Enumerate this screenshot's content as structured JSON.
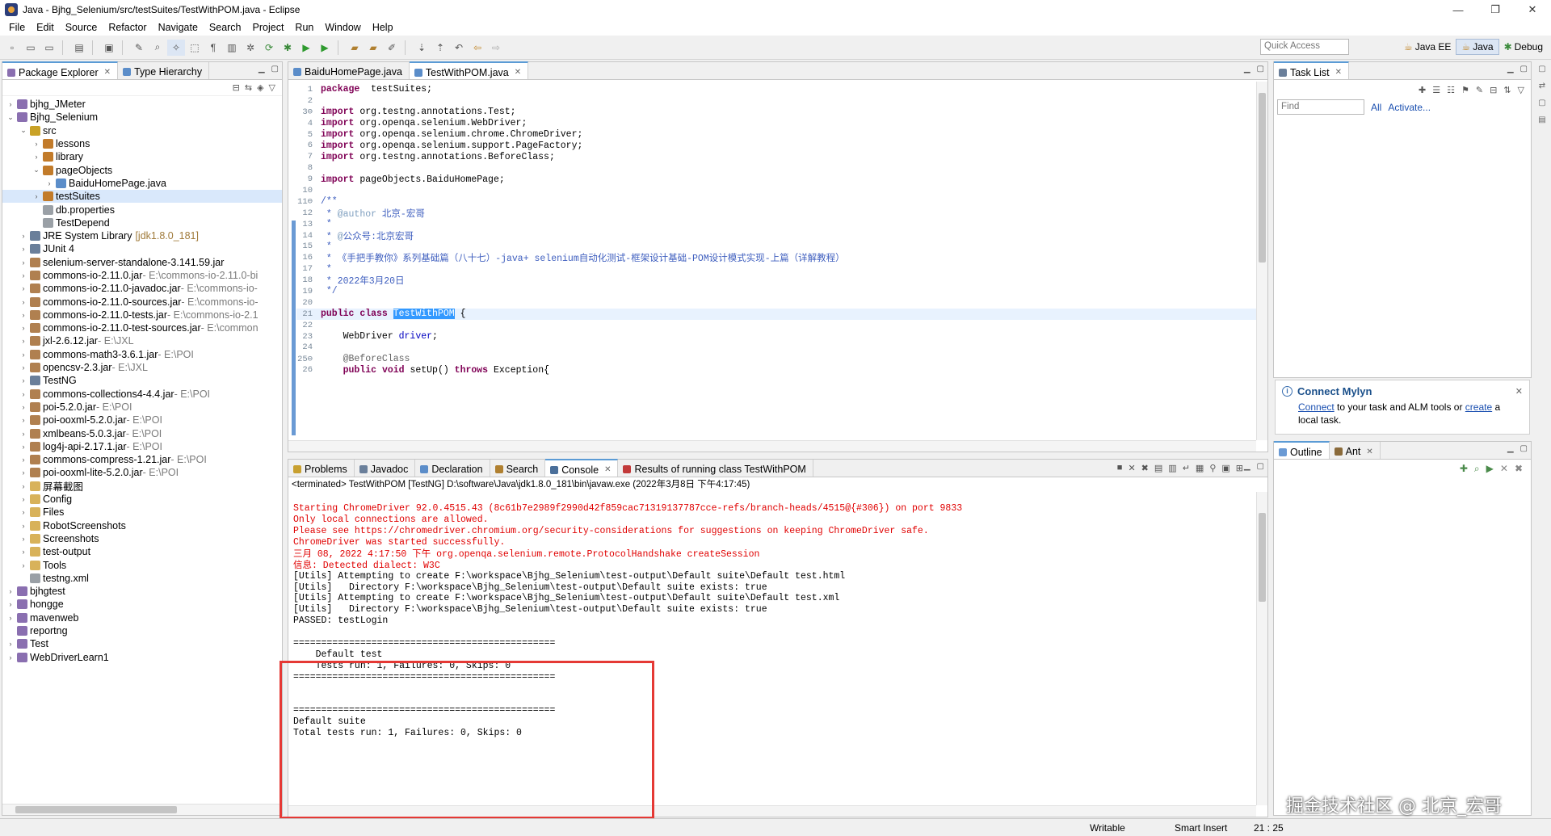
{
  "window": {
    "title": "Java - Bjhg_Selenium/src/testSuites/TestWithPOM.java - Eclipse",
    "minimize": "—",
    "restore": "❐",
    "close": "✕"
  },
  "menu": [
    "File",
    "Edit",
    "Source",
    "Refactor",
    "Navigate",
    "Search",
    "Project",
    "Run",
    "Window",
    "Help"
  ],
  "quick_access": {
    "placeholder": "Quick Access"
  },
  "perspectives": [
    "Java EE",
    "Java",
    "Debug"
  ],
  "package_explorer": {
    "tabs": [
      "Package Explorer",
      "Type Hierarchy"
    ],
    "tree": [
      {
        "label": "bjhg_JMeter",
        "indent": 0,
        "arrow": "›",
        "color": "#8a6fb0"
      },
      {
        "label": "Bjhg_Selenium",
        "indent": 0,
        "arrow": "⌄",
        "color": "#8a6fb0"
      },
      {
        "label": "src",
        "indent": 1,
        "arrow": "⌄",
        "color": "#c9a227"
      },
      {
        "label": "lessons",
        "indent": 2,
        "arrow": "›",
        "color": "#c27b2a"
      },
      {
        "label": "library",
        "indent": 2,
        "arrow": "›",
        "color": "#c27b2a"
      },
      {
        "label": "pageObjects",
        "indent": 2,
        "arrow": "⌄",
        "color": "#c27b2a"
      },
      {
        "label": "BaiduHomePage.java",
        "indent": 3,
        "arrow": "›",
        "color": "#5b8dc9"
      },
      {
        "label": "testSuites",
        "indent": 2,
        "arrow": "›",
        "color": "#c27b2a",
        "selected": true
      },
      {
        "label": "db.properties",
        "indent": 2,
        "arrow": "",
        "color": "#9aa0a6"
      },
      {
        "label": "TestDepend",
        "indent": 2,
        "arrow": "",
        "color": "#9aa0a6"
      },
      {
        "label": "JRE System Library",
        "extra": "[jdk1.8.0_181]",
        "extraClass": "jdk",
        "indent": 1,
        "arrow": "›",
        "color": "#6a7f9a"
      },
      {
        "label": "JUnit 4",
        "indent": 1,
        "arrow": "›",
        "color": "#6a7f9a"
      },
      {
        "label": "selenium-server-standalone-3.141.59.jar",
        "indent": 1,
        "arrow": "›",
        "color": "#b08050"
      },
      {
        "label": "commons-io-2.11.0.jar",
        "extra": " - E:\\commons-io-2.11.0-bi",
        "indent": 1,
        "arrow": "›",
        "color": "#b08050"
      },
      {
        "label": "commons-io-2.11.0-javadoc.jar",
        "extra": " - E:\\commons-io-",
        "indent": 1,
        "arrow": "›",
        "color": "#b08050"
      },
      {
        "label": "commons-io-2.11.0-sources.jar",
        "extra": " - E:\\commons-io-",
        "indent": 1,
        "arrow": "›",
        "color": "#b08050"
      },
      {
        "label": "commons-io-2.11.0-tests.jar",
        "extra": " - E:\\commons-io-2.1",
        "indent": 1,
        "arrow": "›",
        "color": "#b08050"
      },
      {
        "label": "commons-io-2.11.0-test-sources.jar",
        "extra": " - E:\\common",
        "indent": 1,
        "arrow": "›",
        "color": "#b08050"
      },
      {
        "label": "jxl-2.6.12.jar",
        "extra": " - E:\\JXL",
        "indent": 1,
        "arrow": "›",
        "color": "#b08050"
      },
      {
        "label": "commons-math3-3.6.1.jar",
        "extra": " - E:\\POI",
        "indent": 1,
        "arrow": "›",
        "color": "#b08050"
      },
      {
        "label": "opencsv-2.3.jar",
        "extra": " - E:\\JXL",
        "indent": 1,
        "arrow": "›",
        "color": "#b08050"
      },
      {
        "label": "TestNG",
        "indent": 1,
        "arrow": "›",
        "color": "#6a7f9a"
      },
      {
        "label": "commons-collections4-4.4.jar",
        "extra": " - E:\\POI",
        "indent": 1,
        "arrow": "›",
        "color": "#b08050"
      },
      {
        "label": "poi-5.2.0.jar",
        "extra": " - E:\\POI",
        "indent": 1,
        "arrow": "›",
        "color": "#b08050"
      },
      {
        "label": "poi-ooxml-5.2.0.jar",
        "extra": " - E:\\POI",
        "indent": 1,
        "arrow": "›",
        "color": "#b08050"
      },
      {
        "label": "xmlbeans-5.0.3.jar",
        "extra": " - E:\\POI",
        "indent": 1,
        "arrow": "›",
        "color": "#b08050"
      },
      {
        "label": "log4j-api-2.17.1.jar",
        "extra": " - E:\\POI",
        "indent": 1,
        "arrow": "›",
        "color": "#b08050"
      },
      {
        "label": "commons-compress-1.21.jar",
        "extra": " - E:\\POI",
        "indent": 1,
        "arrow": "›",
        "color": "#b08050"
      },
      {
        "label": "poi-ooxml-lite-5.2.0.jar",
        "extra": " - E:\\POI",
        "indent": 1,
        "arrow": "›",
        "color": "#b08050"
      },
      {
        "label": "屏幕截图",
        "indent": 1,
        "arrow": "›",
        "color": "#d8b25a"
      },
      {
        "label": "Config",
        "indent": 1,
        "arrow": "›",
        "color": "#d8b25a"
      },
      {
        "label": "Files",
        "indent": 1,
        "arrow": "›",
        "color": "#d8b25a"
      },
      {
        "label": "RobotScreenshots",
        "indent": 1,
        "arrow": "›",
        "color": "#d8b25a"
      },
      {
        "label": "Screenshots",
        "indent": 1,
        "arrow": "›",
        "color": "#d8b25a"
      },
      {
        "label": "test-output",
        "indent": 1,
        "arrow": "›",
        "color": "#d8b25a"
      },
      {
        "label": "Tools",
        "indent": 1,
        "arrow": "›",
        "color": "#d8b25a"
      },
      {
        "label": "testng.xml",
        "indent": 1,
        "arrow": "",
        "color": "#9aa0a6"
      },
      {
        "label": "bjhgtest",
        "indent": 0,
        "arrow": "›",
        "color": "#8a6fb0"
      },
      {
        "label": "hongge",
        "indent": 0,
        "arrow": "›",
        "color": "#8a6fb0"
      },
      {
        "label": "mavenweb",
        "indent": 0,
        "arrow": "›",
        "color": "#8a6fb0"
      },
      {
        "label": "reportng",
        "indent": 0,
        "arrow": "",
        "color": "#8a6fb0"
      },
      {
        "label": "Test",
        "indent": 0,
        "arrow": "›",
        "color": "#8a6fb0"
      },
      {
        "label": "WebDriverLearn1",
        "indent": 0,
        "arrow": "›",
        "color": "#8a6fb0"
      }
    ]
  },
  "editor": {
    "tabs": [
      "BaiduHomePage.java",
      "TestWithPOM.java"
    ],
    "lines": [
      {
        "n": "1",
        "parts": [
          [
            "kw",
            "package"
          ],
          [
            "",
            "  testSuites;"
          ]
        ]
      },
      {
        "n": "2",
        "parts": []
      },
      {
        "n": "3⊖",
        "parts": [
          [
            "kw",
            "import"
          ],
          [
            "",
            " org.testng.annotations.Test;"
          ]
        ]
      },
      {
        "n": "4",
        "parts": [
          [
            "kw",
            "import"
          ],
          [
            "",
            " org.openqa.selenium.WebDriver;"
          ]
        ]
      },
      {
        "n": "5",
        "parts": [
          [
            "kw",
            "import"
          ],
          [
            "",
            " org.openqa.selenium.chrome.ChromeDriver;"
          ]
        ]
      },
      {
        "n": "6",
        "parts": [
          [
            "kw",
            "import"
          ],
          [
            "",
            " org.openqa.selenium.support.PageFactory;"
          ]
        ]
      },
      {
        "n": "7",
        "parts": [
          [
            "kw",
            "import"
          ],
          [
            "",
            " org.testng.annotations.BeforeClass;"
          ]
        ]
      },
      {
        "n": "8",
        "parts": []
      },
      {
        "n": "9",
        "parts": [
          [
            "kw",
            "import"
          ],
          [
            "",
            " pageObjects.BaiduHomePage;"
          ]
        ]
      },
      {
        "n": "10",
        "parts": []
      },
      {
        "n": "11⊖",
        "parts": [
          [
            "jd",
            "/**"
          ]
        ]
      },
      {
        "n": "12",
        "parts": [
          [
            "jd",
            " * "
          ],
          [
            "tag",
            "@author"
          ],
          [
            "jd",
            " 北京-宏哥"
          ]
        ]
      },
      {
        "n": "13",
        "parts": [
          [
            "jd",
            " *"
          ]
        ]
      },
      {
        "n": "14",
        "parts": [
          [
            "jd",
            " * "
          ],
          [
            "tag",
            "@"
          ],
          [
            "jd",
            "公众号:北京宏哥"
          ]
        ]
      },
      {
        "n": "15",
        "parts": [
          [
            "jd",
            " *"
          ]
        ]
      },
      {
        "n": "16",
        "parts": [
          [
            "jd",
            " * 《手把手教你》系列基础篇（八十七）-java+ selenium自动化测试-框架设计基础-POM设计模式实现-上篇（详解教程）"
          ]
        ]
      },
      {
        "n": "17",
        "parts": [
          [
            "jd",
            " *"
          ]
        ]
      },
      {
        "n": "18",
        "parts": [
          [
            "jd",
            " * 2022年3月20日"
          ]
        ]
      },
      {
        "n": "19",
        "parts": [
          [
            "jd",
            " */"
          ]
        ]
      },
      {
        "n": "20",
        "parts": []
      },
      {
        "n": "21",
        "hl": true,
        "parts": [
          [
            "kw",
            "public"
          ],
          [
            "",
            " "
          ],
          [
            "kw",
            "class"
          ],
          [
            "",
            " "
          ],
          [
            "sel",
            "TestWithPOM"
          ],
          [
            "",
            " {"
          ]
        ]
      },
      {
        "n": "22",
        "parts": []
      },
      {
        "n": "23",
        "parts": [
          [
            "",
            "    WebDriver "
          ],
          [
            "fld",
            "driver"
          ],
          [
            "",
            ";"
          ]
        ]
      },
      {
        "n": "24",
        "parts": []
      },
      {
        "n": "25⊖",
        "parts": [
          [
            "ann",
            "    @BeforeClass"
          ]
        ]
      },
      {
        "n": "26",
        "parts": [
          [
            "",
            "    "
          ],
          [
            "kw",
            "public"
          ],
          [
            "",
            " "
          ],
          [
            "kw",
            "void"
          ],
          [
            "",
            " setUp() "
          ],
          [
            "kw",
            "throws"
          ],
          [
            "",
            " Exception{"
          ]
        ]
      }
    ]
  },
  "task_list": {
    "tab": "Task List",
    "find_placeholder": "Find",
    "all": "All",
    "activate": "Activate..."
  },
  "mylyn": {
    "title": "Connect Mylyn",
    "connect": "Connect",
    "text1": " to your task and ALM tools or ",
    "create": "create",
    "text2": " a",
    "text3": "local task."
  },
  "outline": {
    "tabs": [
      "Outline",
      "Ant"
    ]
  },
  "console": {
    "tabs": [
      "Problems",
      "Javadoc",
      "Declaration",
      "Search",
      "Console",
      "Results of running class TestWithPOM"
    ],
    "header": "<terminated> TestWithPOM [TestNG] D:\\software\\Java\\jdk1.8.0_181\\bin\\javaw.exe (2022年3月8日 下午4:17:45)",
    "lines": [
      {
        "t": "",
        "c": ""
      },
      {
        "t": "Starting ChromeDriver 92.0.4515.43 (8c61b7e2989f2990d42f859cac71319137787cce-refs/branch-heads/4515@{#306}) on port 9833",
        "c": "err"
      },
      {
        "t": "Only local connections are allowed.",
        "c": "err"
      },
      {
        "t": "Please see https://chromedriver.chromium.org/security-considerations for suggestions on keeping ChromeDriver safe.",
        "c": "err"
      },
      {
        "t": "ChromeDriver was started successfully.",
        "c": "err"
      },
      {
        "t": "三月 08, 2022 4:17:50 下午 org.openqa.selenium.remote.ProtocolHandshake createSession",
        "c": "err"
      },
      {
        "t": "信息: Detected dialect: W3C",
        "c": "err"
      },
      {
        "t": "[Utils] Attempting to create F:\\workspace\\Bjhg_Selenium\\test-output\\Default suite\\Default test.html",
        "c": ""
      },
      {
        "t": "[Utils]   Directory F:\\workspace\\Bjhg_Selenium\\test-output\\Default suite exists: true",
        "c": ""
      },
      {
        "t": "[Utils] Attempting to create F:\\workspace\\Bjhg_Selenium\\test-output\\Default suite\\Default test.xml",
        "c": ""
      },
      {
        "t": "[Utils]   Directory F:\\workspace\\Bjhg_Selenium\\test-output\\Default suite exists: true",
        "c": ""
      },
      {
        "t": "PASSED: testLogin",
        "c": ""
      },
      {
        "t": "",
        "c": ""
      },
      {
        "t": "===============================================",
        "c": ""
      },
      {
        "t": "    Default test",
        "c": ""
      },
      {
        "t": "    Tests run: 1, Failures: 0, Skips: 0",
        "c": ""
      },
      {
        "t": "===============================================",
        "c": ""
      },
      {
        "t": "",
        "c": ""
      },
      {
        "t": "",
        "c": ""
      },
      {
        "t": "===============================================",
        "c": ""
      },
      {
        "t": "Default suite",
        "c": ""
      },
      {
        "t": "Total tests run: 1, Failures: 0, Skips: 0",
        "c": ""
      }
    ]
  },
  "status": {
    "writable": "Writable",
    "insert": "Smart Insert",
    "pos": "21 : 25"
  },
  "watermark": "掘金技术社区 @ 北京_宏哥"
}
